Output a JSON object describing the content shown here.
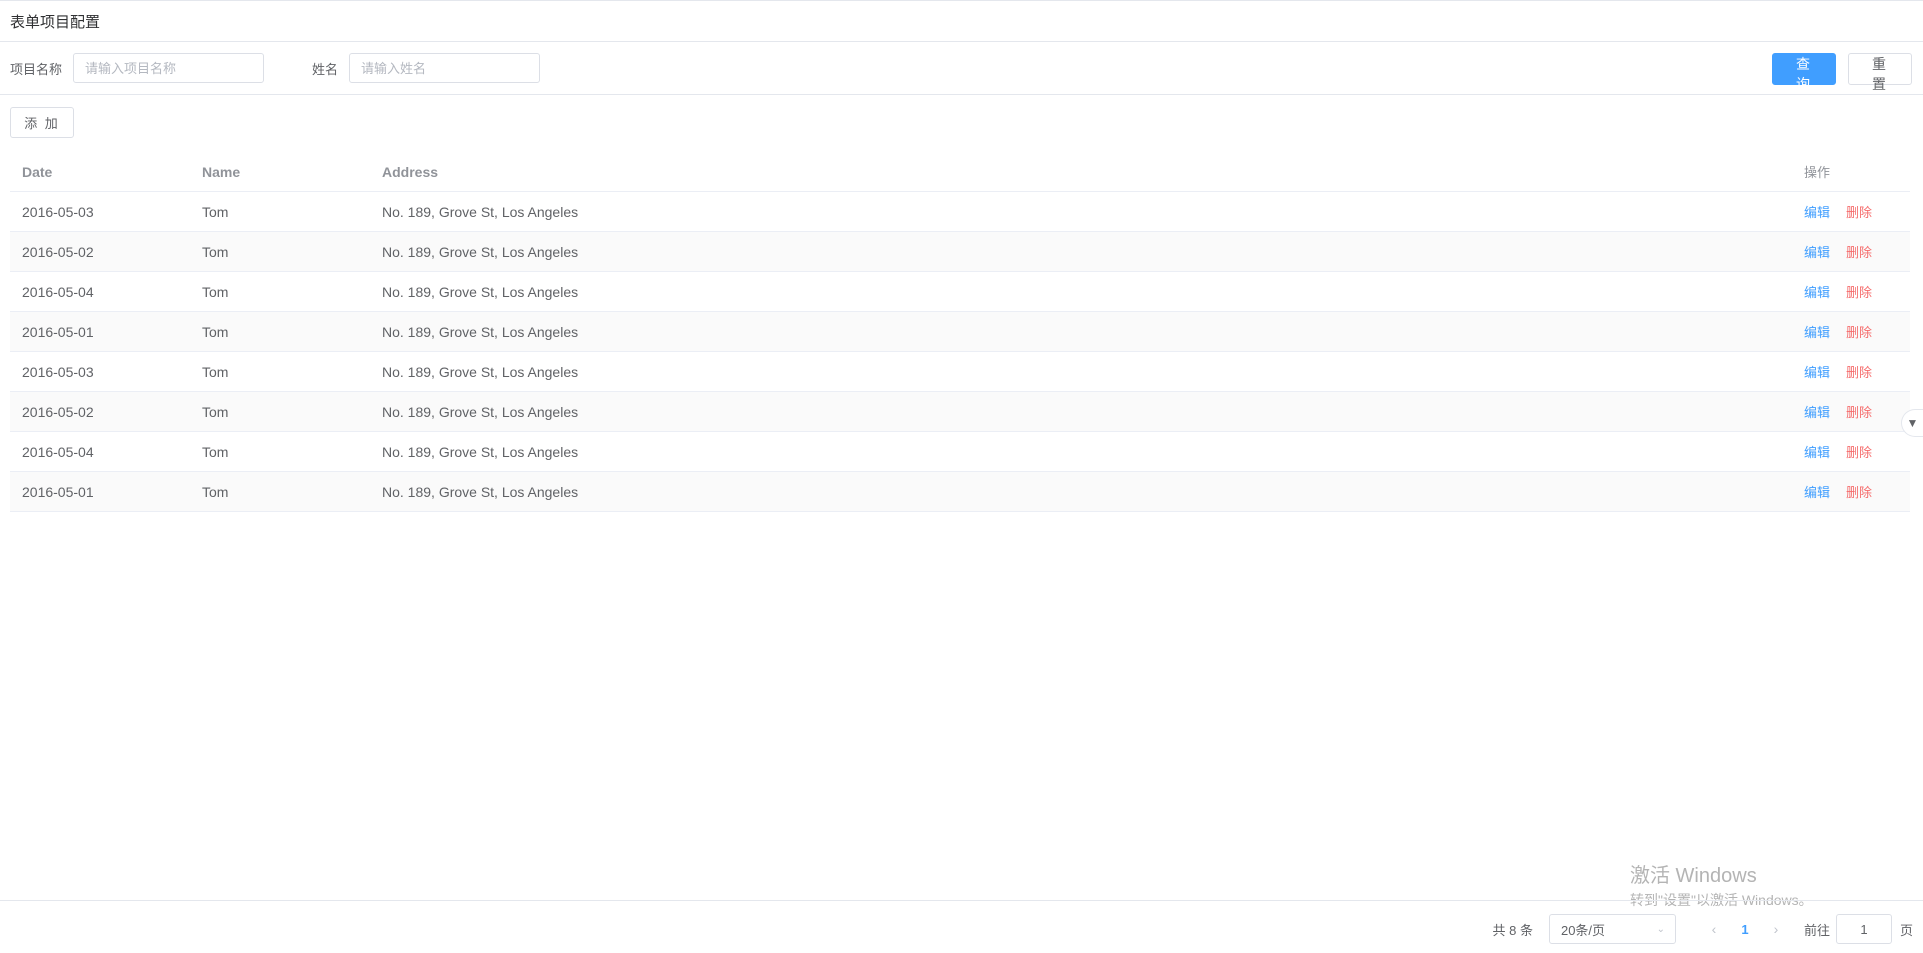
{
  "page": {
    "title": "表单项目配置"
  },
  "search": {
    "project_label": "项目名称",
    "project_placeholder": "请输入项目名称",
    "name_label": "姓名",
    "name_placeholder": "请输入姓名",
    "query_label": "查 询",
    "reset_label": "重 置"
  },
  "toolbar": {
    "add_label": "添 加"
  },
  "table": {
    "headers": {
      "date": "Date",
      "name": "Name",
      "address": "Address",
      "ops": "操作"
    },
    "edit_label": "编辑",
    "delete_label": "删除",
    "rows": [
      {
        "date": "2016-05-03",
        "name": "Tom",
        "address": "No. 189, Grove St, Los Angeles"
      },
      {
        "date": "2016-05-02",
        "name": "Tom",
        "address": "No. 189, Grove St, Los Angeles"
      },
      {
        "date": "2016-05-04",
        "name": "Tom",
        "address": "No. 189, Grove St, Los Angeles"
      },
      {
        "date": "2016-05-01",
        "name": "Tom",
        "address": "No. 189, Grove St, Los Angeles"
      },
      {
        "date": "2016-05-03",
        "name": "Tom",
        "address": "No. 189, Grove St, Los Angeles"
      },
      {
        "date": "2016-05-02",
        "name": "Tom",
        "address": "No. 189, Grove St, Los Angeles"
      },
      {
        "date": "2016-05-04",
        "name": "Tom",
        "address": "No. 189, Grove St, Los Angeles"
      },
      {
        "date": "2016-05-01",
        "name": "Tom",
        "address": "No. 189, Grove St, Los Angeles"
      }
    ]
  },
  "pagination": {
    "total": "共 8 条",
    "page_size": "20条/页",
    "current_page": "1",
    "goto_label": "前往",
    "goto_value": "1",
    "page_suffix": "页"
  },
  "watermark": {
    "title": "激活 Windows",
    "subtitle": "转到\"设置\"以激活 Windows。"
  },
  "colors": {
    "primary": "#409eff",
    "danger": "#f56c6c"
  },
  "icons": {
    "side_handle": "double-chevron-down-icon",
    "select": "chevron-down-icon",
    "prev": "chevron-left-icon",
    "next": "chevron-right-icon"
  }
}
